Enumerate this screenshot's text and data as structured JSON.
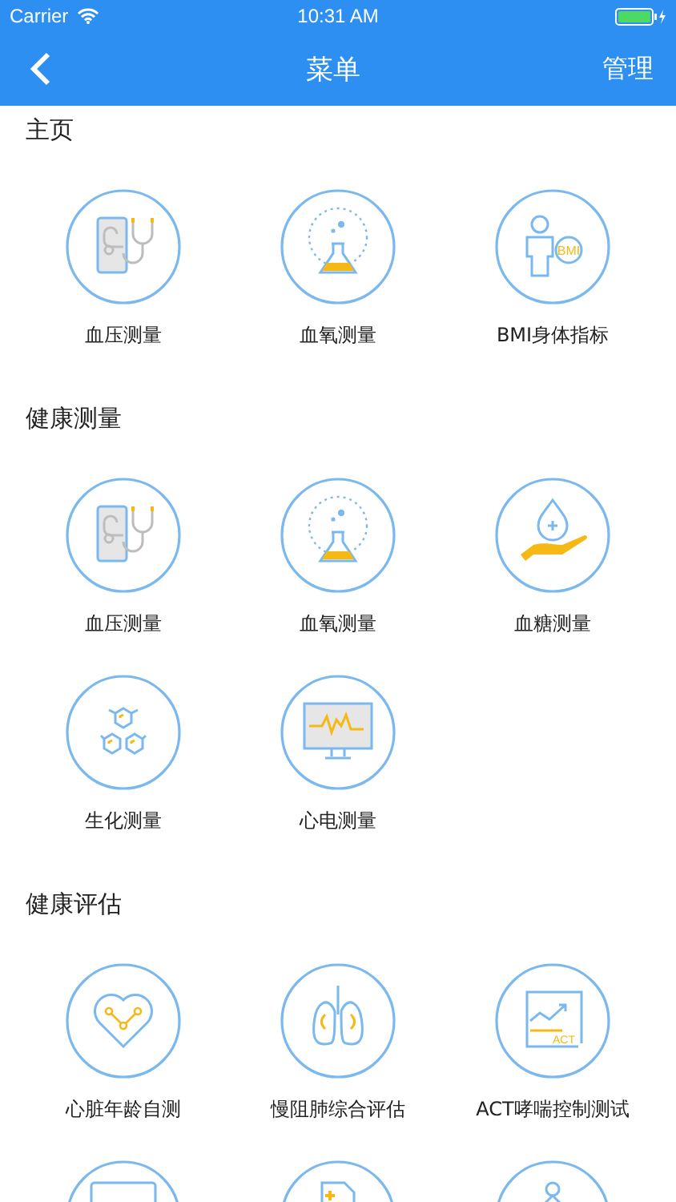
{
  "status_bar": {
    "carrier": "Carrier",
    "time": "10:31 AM"
  },
  "nav_bar": {
    "title": "菜单",
    "action": "管理"
  },
  "sections": [
    {
      "title": "主页",
      "items": [
        {
          "kind": "blood-pressure",
          "label": "血压测量"
        },
        {
          "kind": "flask",
          "label": "血氧测量"
        },
        {
          "kind": "bmi",
          "label": "BMI身体指标",
          "badge": "BMI"
        }
      ]
    },
    {
      "title": "健康测量",
      "items": [
        {
          "kind": "blood-pressure",
          "label": "血压测量"
        },
        {
          "kind": "flask",
          "label": "血氧测量"
        },
        {
          "kind": "drop-hand",
          "label": "血糖测量"
        },
        {
          "kind": "hexagons",
          "label": "生化测量"
        },
        {
          "kind": "monitor",
          "label": "心电测量"
        }
      ]
    },
    {
      "title": "健康评估",
      "items": [
        {
          "kind": "heart",
          "label": "心脏年龄自测"
        },
        {
          "kind": "lungs",
          "label": "慢阻肺综合评估"
        },
        {
          "kind": "chart",
          "label": "ACT哮喘控制测试",
          "badge": "ACT"
        },
        {
          "kind": "screen"
        },
        {
          "kind": "document"
        },
        {
          "kind": "person"
        }
      ]
    }
  ]
}
